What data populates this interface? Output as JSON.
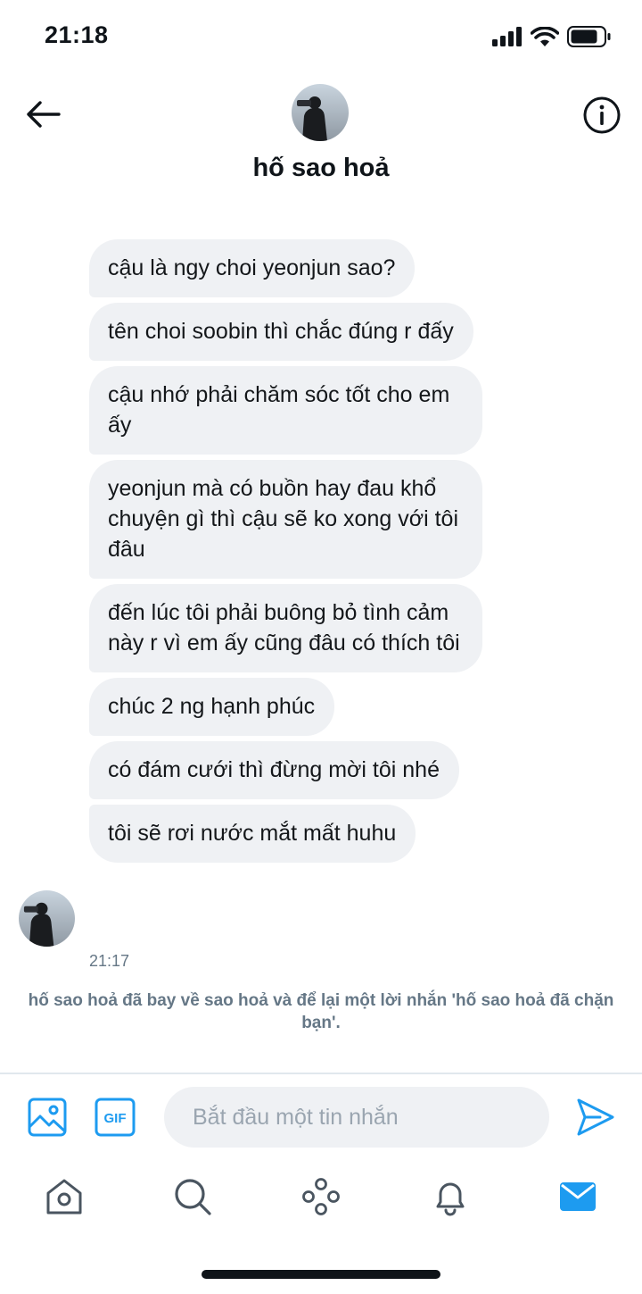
{
  "status_bar": {
    "time": "21:18"
  },
  "header": {
    "title": "hố sao hoả"
  },
  "messages": [
    "cậu là ngy choi yeonjun sao?",
    "tên choi soobin thì chắc đúng r đấy",
    "cậu nhớ phải chăm sóc tốt cho em ấy",
    "yeonjun mà có buồn hay đau khổ chuyện gì thì cậu sẽ ko xong với tôi đâu",
    "đến lúc tôi phải buông bỏ tình cảm này r vì em ấy cũng đâu có thích tôi",
    "chúc 2 ng hạnh phúc",
    "có đám cưới thì đừng mời tôi nhé",
    "tôi sẽ rơi nước mắt mất huhu"
  ],
  "last_message_time": "21:17",
  "system_note": "hố sao hoả đã bay về sao hoả và để lại một lời nhắn 'hố sao hoả đã chặn bạn'.",
  "composer": {
    "placeholder": "Bắt đầu một tin nhắn",
    "value": "",
    "gif_label": "GIF"
  },
  "icons": {
    "back": "back-arrow-icon",
    "info": "info-icon",
    "media": "image-icon",
    "gif": "gif-icon",
    "send": "send-icon",
    "tabs": [
      "home-icon",
      "search-icon",
      "spaces-icon",
      "notifications-icon",
      "messages-icon"
    ]
  },
  "colors": {
    "accent": "#1d9bf0",
    "bubble": "#eff1f4",
    "muted": "#657786"
  }
}
